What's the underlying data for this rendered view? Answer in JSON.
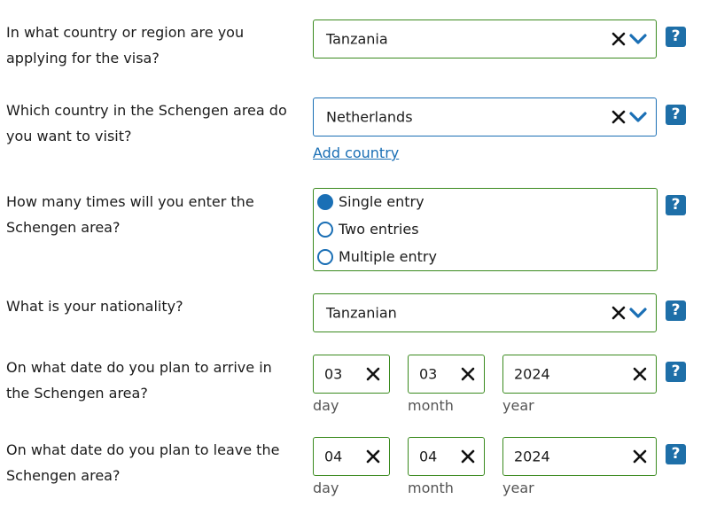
{
  "q1": {
    "label": "In what country or region are you applying for the visa?",
    "value": "Tanzania"
  },
  "q2": {
    "label": "Which country in the Schengen area do you want to visit?",
    "value": "Netherlands",
    "add_link": "Add country"
  },
  "q3": {
    "label": "How many times will you enter the Schengen area?",
    "options": [
      "Single entry",
      "Two entries",
      "Multiple entry"
    ],
    "selected": "Single entry"
  },
  "q4": {
    "label": "What is your nationality?",
    "value": "Tanzanian"
  },
  "q5": {
    "label": "On what date do you plan to arrive in the Schengen area?",
    "day": "03",
    "month": "03",
    "year": "2024"
  },
  "q6": {
    "label": "On what date do you plan to leave the Schengen area?",
    "day": "04",
    "month": "04",
    "year": "2024"
  },
  "date_labels": {
    "day": "day",
    "month": "month",
    "year": "year"
  },
  "help_symbol": "?",
  "colors": {
    "valid_border": "#3a8a1e",
    "active_border": "#1a6fb5",
    "accent": "#1a6fb5",
    "help_bg": "#1e6fa8"
  },
  "icons": {
    "clear": "close-icon",
    "dropdown": "chevron-down-icon",
    "help": "help-icon"
  }
}
